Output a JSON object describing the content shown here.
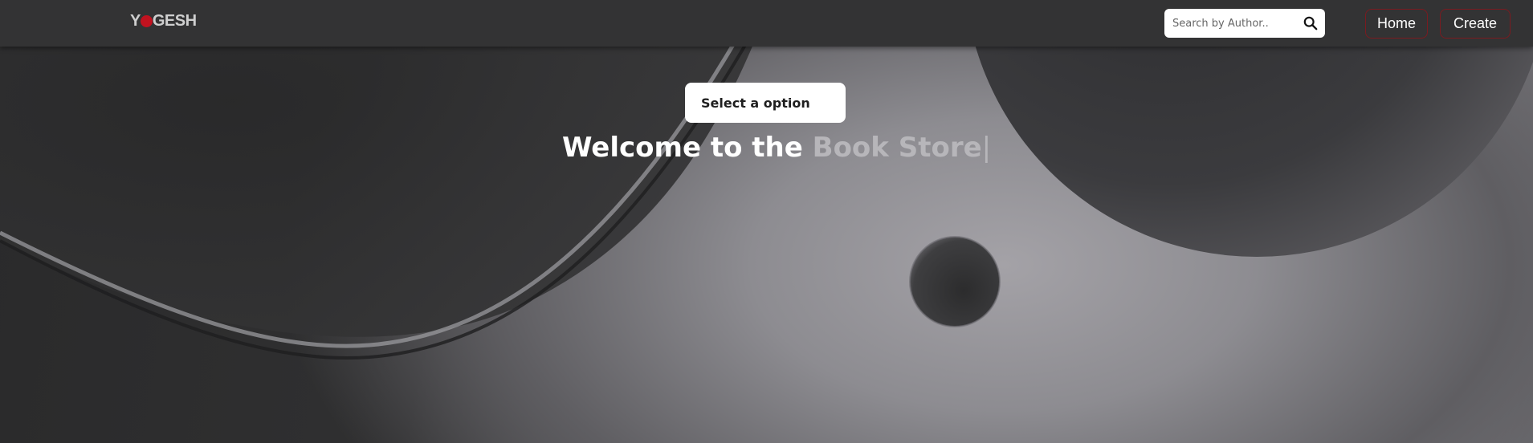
{
  "brand": {
    "logo_text_left": "Y",
    "logo_text_right": "GESH"
  },
  "search": {
    "placeholder": "Search by Author.."
  },
  "nav": {
    "home_label": "Home",
    "create_label": "Create"
  },
  "select": {
    "label": "Select a option"
  },
  "hero": {
    "prefix": "Welcome to the ",
    "highlight": "Book Store",
    "cursor": "|"
  },
  "colors": {
    "navbar": "#333334",
    "logo_accent": "#c1121f",
    "button_border": "#7a1b20"
  }
}
